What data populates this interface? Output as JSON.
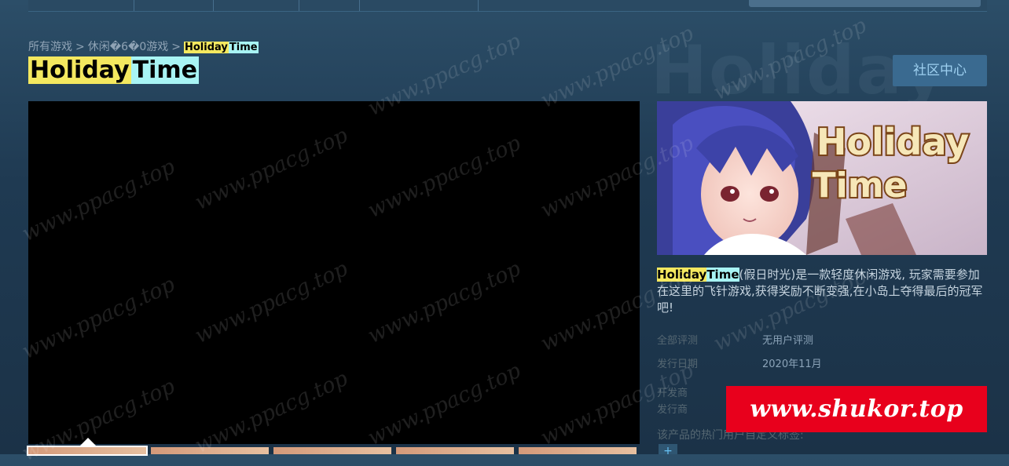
{
  "breadcrumb": {
    "items": [
      "所有游戏",
      "休闲�6�0游戏"
    ],
    "separator": ">",
    "current_part1": "Holiday",
    "current_part2": "Time"
  },
  "game": {
    "title_part1": "Holiday",
    "title_part2": "Time",
    "capsule_logo_line1": "Holiday",
    "capsule_logo_line2": "Time",
    "background_logo": "Holiday"
  },
  "community_button": "社区中心",
  "description": {
    "name_part1": "Holiday",
    "name_part2": "Time",
    "text": "(假日时光)是一款轻度休闲游戏, 玩家需要参加在这里的飞针游戏,获得奖励不断变强,在小岛上夺得最后的冠军吧!"
  },
  "info": {
    "reviews_label": "全部评测",
    "reviews_value": "无用户评测",
    "release_label": "发行日期",
    "release_value": "2020年11月",
    "developer_label": "开发商",
    "publisher_label": "发行商"
  },
  "tags": {
    "label": "该产品的热门用户自定义标签:",
    "add": "+"
  },
  "watermark": {
    "banner": "www.shukor.top",
    "overlay": "www.ppacg.top"
  },
  "colors": {
    "highlight_yellow": "#f4e85f",
    "highlight_cyan": "#a8f4f4",
    "watermark_red": "#e8001c",
    "button_bg": "#3a6a90"
  }
}
